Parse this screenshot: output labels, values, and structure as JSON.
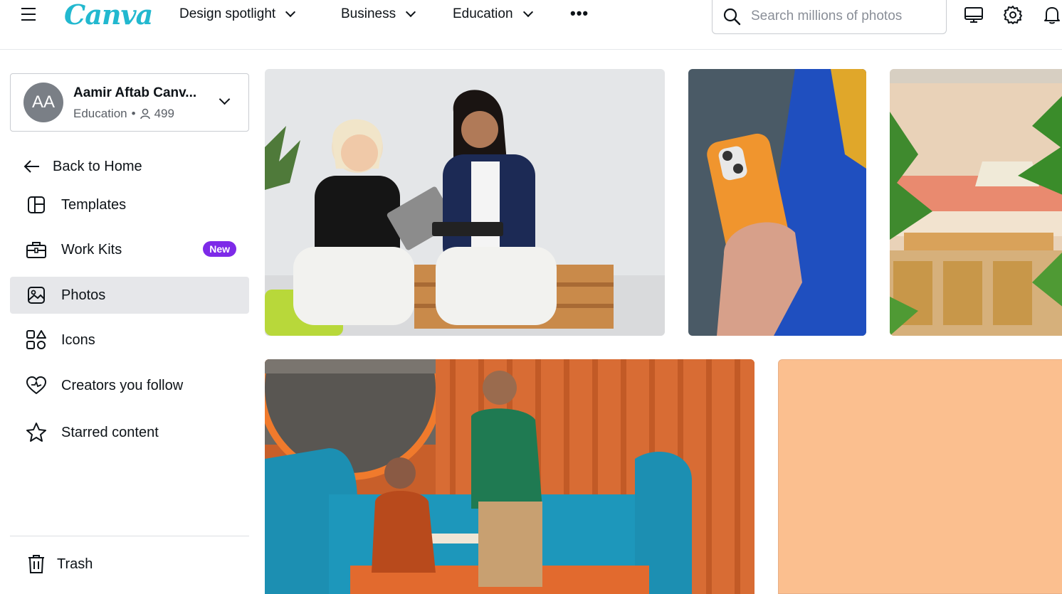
{
  "header": {
    "logo": "Canva",
    "nav": [
      {
        "label": "Design spotlight"
      },
      {
        "label": "Business"
      },
      {
        "label": "Education"
      }
    ],
    "more_label": "•••",
    "search": {
      "placeholder": "Search millions of photos"
    },
    "icons": [
      "desktop-icon",
      "gear-icon",
      "bell-icon"
    ]
  },
  "account": {
    "initials": "AA",
    "name": "Aamir Aftab Canv...",
    "plan": "Education",
    "separator": "•",
    "members": "499"
  },
  "sidebar": {
    "items": [
      {
        "label": "Back to Home",
        "icon": "arrow-left-icon"
      },
      {
        "label": "Templates",
        "icon": "templates-icon"
      },
      {
        "label": "Work Kits",
        "icon": "briefcase-icon",
        "badge": "New"
      },
      {
        "label": "Photos",
        "icon": "image-icon",
        "active": true
      },
      {
        "label": "Icons",
        "icon": "shapes-icon"
      },
      {
        "label": "Creators you follow",
        "icon": "heart-icon"
      },
      {
        "label": "Starred content",
        "icon": "star-icon"
      }
    ],
    "trash_label": "Trash"
  },
  "colors": {
    "brand_teal": "#22b8cf",
    "brand_purple": "#7d2ae8",
    "active_bg": "#e6e7ea",
    "peach": "#fbbf8f"
  }
}
